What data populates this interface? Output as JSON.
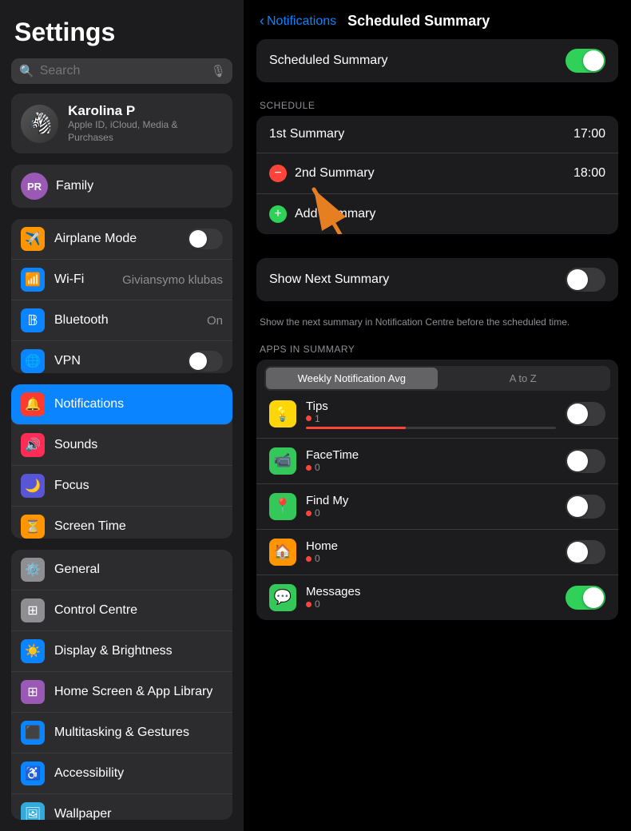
{
  "sidebar": {
    "title": "Settings",
    "search": {
      "placeholder": "Search"
    },
    "account": {
      "name": "Karolina P",
      "subtitle": "Apple ID, iCloud, Media & Purchases"
    },
    "family": {
      "initials": "PR",
      "label": "Family"
    },
    "group1": [
      {
        "id": "airplane",
        "label": "Airplane Mode",
        "icon": "✈️",
        "bg": "#ff9500",
        "control": "toggle",
        "value": false
      },
      {
        "id": "wifi",
        "label": "Wi-Fi",
        "icon": "📶",
        "bg": "#0a84ff",
        "control": "value",
        "value": "Giviansymo klubas"
      },
      {
        "id": "bluetooth",
        "label": "Bluetooth",
        "icon": "⬤",
        "bg": "#0a84ff",
        "control": "value",
        "value": "On"
      },
      {
        "id": "vpn",
        "label": "VPN",
        "icon": "🌐",
        "bg": "#0a84ff",
        "control": "toggle",
        "value": false
      }
    ],
    "group2": [
      {
        "id": "notifications",
        "label": "Notifications",
        "icon": "🔔",
        "bg": "#ff3b30",
        "active": true
      },
      {
        "id": "sounds",
        "label": "Sounds",
        "icon": "🔊",
        "bg": "#ff2d55"
      },
      {
        "id": "focus",
        "label": "Focus",
        "icon": "🌙",
        "bg": "#5856d6"
      },
      {
        "id": "screentime",
        "label": "Screen Time",
        "icon": "⏳",
        "bg": "#ff9500"
      }
    ],
    "group3": [
      {
        "id": "general",
        "label": "General",
        "icon": "⚙️",
        "bg": "#8e8e93"
      },
      {
        "id": "controlcentre",
        "label": "Control Centre",
        "icon": "⊞",
        "bg": "#8e8e93"
      },
      {
        "id": "display",
        "label": "Display & Brightness",
        "icon": "☀️",
        "bg": "#0a84ff"
      },
      {
        "id": "homescreen",
        "label": "Home Screen & App Library",
        "icon": "⊞",
        "bg": "#9b59b6"
      },
      {
        "id": "multitasking",
        "label": "Multitasking & Gestures",
        "icon": "⬛",
        "bg": "#0a84ff"
      },
      {
        "id": "accessibility",
        "label": "Accessibility",
        "icon": "♿",
        "bg": "#0a84ff"
      },
      {
        "id": "wallpaper",
        "label": "Wallpaper",
        "icon": "🖼",
        "bg": "#34aadc"
      }
    ]
  },
  "right": {
    "nav": {
      "back_label": "Notifications",
      "title": "Scheduled Summary"
    },
    "scheduled_summary": {
      "label": "Scheduled Summary",
      "enabled": true
    },
    "schedule_section": "SCHEDULE",
    "summaries": [
      {
        "label": "1st Summary",
        "time": "17:00",
        "removable": false
      },
      {
        "label": "2nd Summary",
        "time": "18:00",
        "removable": true
      }
    ],
    "add_summary": "Add Summary",
    "show_next": {
      "label": "Show Next Summary",
      "enabled": false
    },
    "show_next_helper": "Show the next summary in Notification Centre before the scheduled time.",
    "apps_section": "APPS IN SUMMARY",
    "sort_tabs": [
      {
        "label": "Weekly Notification Avg",
        "active": true
      },
      {
        "label": "A to Z",
        "active": false
      }
    ],
    "apps": [
      {
        "id": "tips",
        "name": "Tips",
        "icon": "💡",
        "bg": "#ffd60a",
        "count": "1",
        "has_bar": true,
        "bar_pct": 40,
        "enabled": false
      },
      {
        "id": "facetime",
        "name": "FaceTime",
        "icon": "📹",
        "bg": "#34c759",
        "count": "0",
        "has_bar": false,
        "enabled": false
      },
      {
        "id": "findmy",
        "name": "Find My",
        "icon": "📍",
        "bg": "#34c759",
        "count": "0",
        "has_bar": false,
        "enabled": false
      },
      {
        "id": "home",
        "name": "Home",
        "icon": "🏠",
        "bg": "#ff9500",
        "count": "0",
        "has_bar": false,
        "enabled": false
      },
      {
        "id": "messages",
        "name": "Messages",
        "icon": "💬",
        "bg": "#34c759",
        "count": "0",
        "has_bar": false,
        "enabled": true
      }
    ]
  }
}
